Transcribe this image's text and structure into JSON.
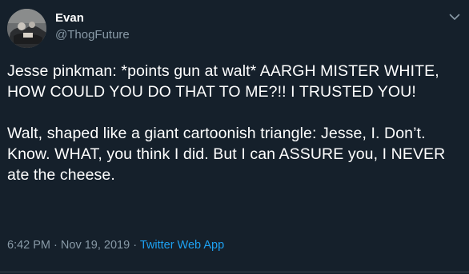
{
  "author": {
    "display_name": "Evan",
    "handle": "@ThogFuture"
  },
  "tweet": {
    "text": "Jesse pinkman: *points gun at walt* AARGH MISTER WHITE, HOW COULD YOU DO THAT TO ME?!! I TRUSTED YOU!\n\nWalt, shaped like a giant cartoonish triangle: Jesse, I. Don’t. Know. WHAT, you think I did. But I can ASSURE you, I NEVER ate the cheese.",
    "time": "6:42 PM",
    "separator": "·",
    "date": "Nov 19, 2019",
    "source": "Twitter Web App"
  },
  "icons": {
    "caret": "chevron-down-icon",
    "avatar": "avatar"
  },
  "colors": {
    "background": "#15202b",
    "text_primary": "#ffffff",
    "text_secondary": "#8899a6",
    "link": "#1da1f2",
    "divider": "#38444d"
  }
}
